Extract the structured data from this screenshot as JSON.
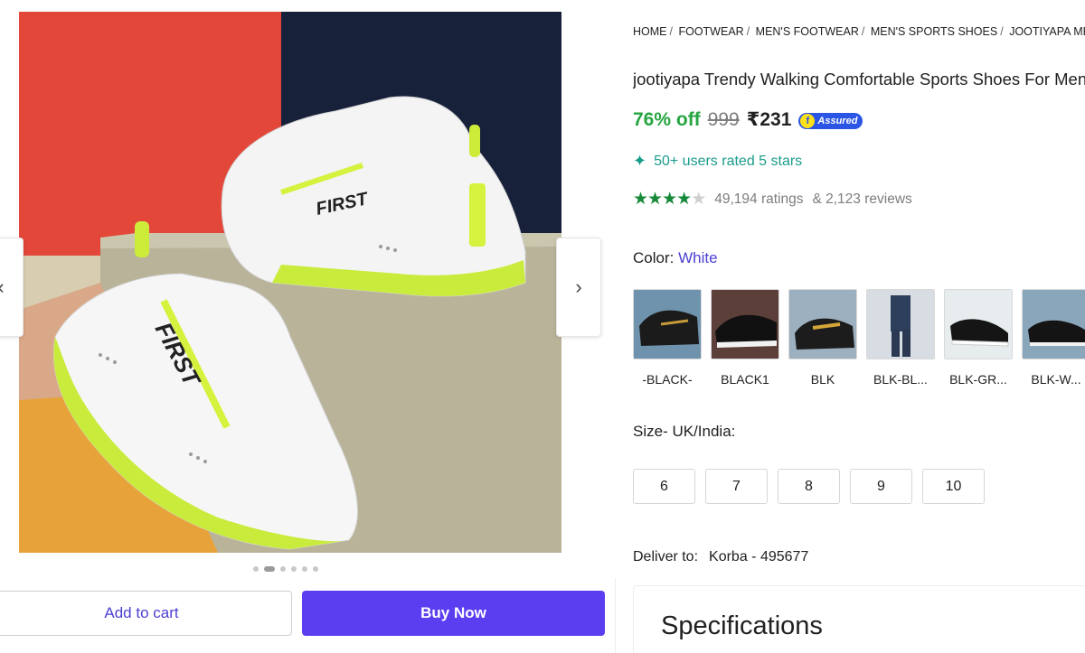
{
  "breadcrumb": [
    "HOME",
    "FOOTWEAR",
    "MEN'S FOOTWEAR",
    "MEN'S SPORTS SHOES",
    "JOOTIYAPA MEN'S"
  ],
  "product": {
    "title": "jootiyapa Trendy Walking Comfortable Sports Shoes For Men",
    "discount": "76% off",
    "mrp": "999",
    "price": "₹231",
    "assured_label": "Assured",
    "social_proof": "50+ users rated 5 stars",
    "rating_stars": 4,
    "ratings_count": "49,194 ratings",
    "reviews_count": "& 2,123 reviews"
  },
  "image": {
    "brand_text_1": "FIRST",
    "brand_text_2": "FIRST"
  },
  "gallery": {
    "dots": 6,
    "active_dot": 1
  },
  "color": {
    "label": "Color:",
    "selected": "White"
  },
  "swatches": [
    {
      "label": "-BLACK-"
    },
    {
      "label": "BLACK1"
    },
    {
      "label": "BLK"
    },
    {
      "label": "BLK-BL..."
    },
    {
      "label": "BLK-GR..."
    },
    {
      "label": "BLK-W..."
    }
  ],
  "size": {
    "label": "Size- UK/India:",
    "options": [
      "6",
      "7",
      "8",
      "9",
      "10"
    ]
  },
  "delivery": {
    "label": "Deliver to:",
    "location": "Korba - 495677"
  },
  "actions": {
    "add_to_cart": "Add to cart",
    "buy_now": "Buy Now"
  },
  "specifications": {
    "title": "Specifications"
  },
  "colors": {
    "accent": "#5b3ef0",
    "link": "#4b3fd1",
    "discount": "#26a541",
    "rated": "#1a9c8a",
    "star": "#178a3a"
  }
}
